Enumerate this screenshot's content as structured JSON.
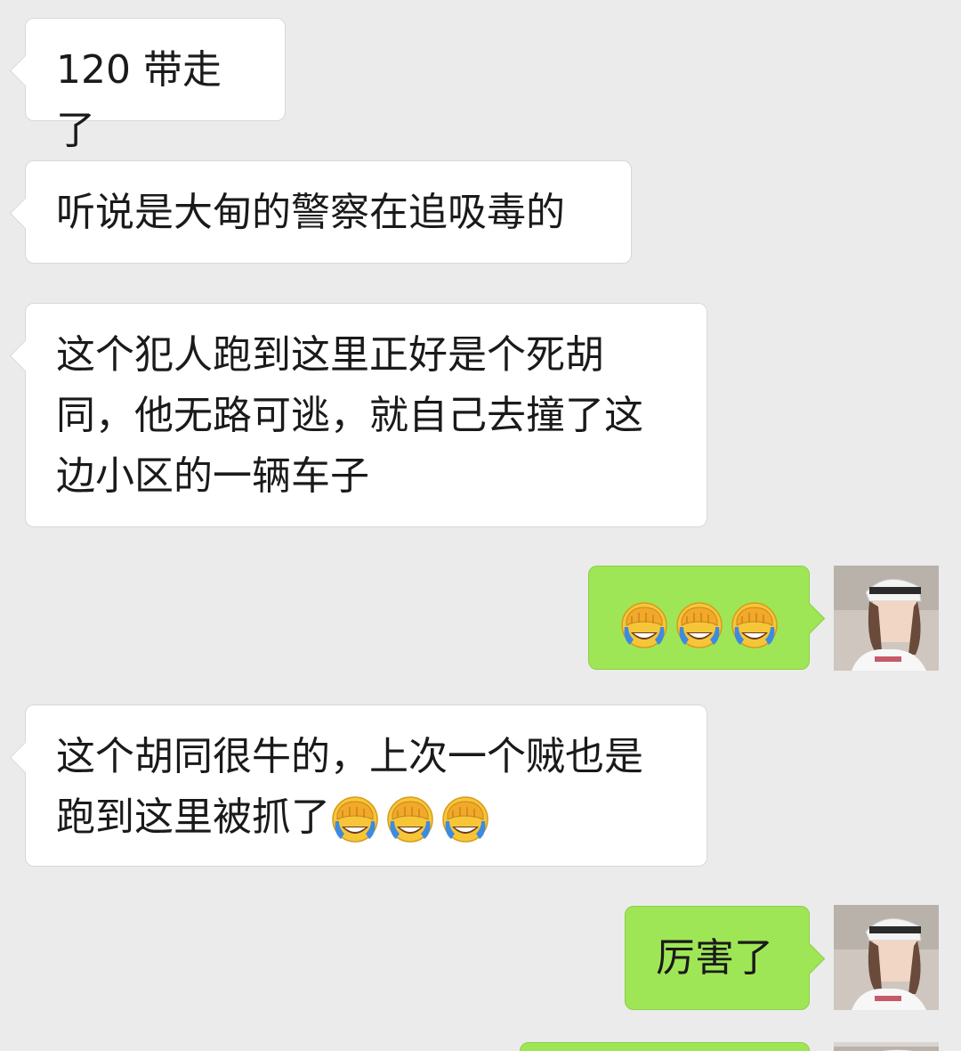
{
  "messages": [
    {
      "id": 1,
      "direction": "incoming",
      "text": "120 带走了"
    },
    {
      "id": 2,
      "direction": "incoming",
      "text": "听说是大甸的警察在追吸毒的"
    },
    {
      "id": 3,
      "direction": "incoming",
      "text": "这个犯人跑到这里正好是个死胡同，他无路可逃，就自己去撞了这边小区的一辆车子"
    },
    {
      "id": 4,
      "direction": "outgoing",
      "emojis": [
        "facepalm-crying-emoji",
        "facepalm-crying-emoji",
        "facepalm-crying-emoji"
      ]
    },
    {
      "id": 5,
      "direction": "incoming",
      "text": "这个胡同很牛的，上次一个贼也是跑到这里被抓了",
      "emojis": [
        "facepalm-crying-emoji",
        "facepalm-crying-emoji",
        "facepalm-crying-emoji"
      ]
    },
    {
      "id": 6,
      "direction": "outgoing",
      "text": "厉害了"
    },
    {
      "id": 7,
      "direction": "outgoing",
      "text": ""
    }
  ],
  "colors": {
    "background": "#ebebeb",
    "incoming_bubble": "#ffffff",
    "outgoing_bubble": "#9fe657"
  }
}
